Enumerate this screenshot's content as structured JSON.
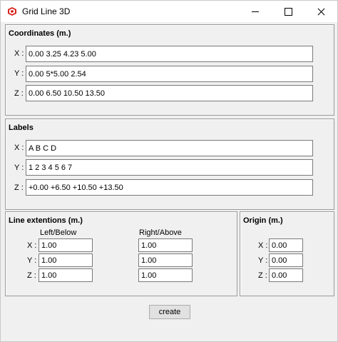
{
  "window": {
    "title": "Grid Line 3D"
  },
  "coordinates": {
    "title": "Coordinates (m.)",
    "rows": [
      {
        "label": "X :",
        "value": "0.00 3.25 4.23 5.00"
      },
      {
        "label": "Y :",
        "value": "0.00 5*5.00 2.54"
      },
      {
        "label": "Z :",
        "value": "0.00 6.50 10.50 13.50"
      }
    ]
  },
  "labels": {
    "title": "Labels",
    "rows": [
      {
        "label": "X :",
        "value": "A B C D"
      },
      {
        "label": "Y :",
        "value": "1 2 3 4 5 6 7"
      },
      {
        "label": "Z :",
        "value": "+0.00 +6.50 +10.50 +13.50"
      }
    ]
  },
  "extensions": {
    "title": "Line extentions (m.)",
    "col_left": "Left/Below",
    "col_right": "Right/Above",
    "rows": [
      {
        "label": "X :",
        "left": "1.00",
        "right": "1.00"
      },
      {
        "label": "Y :",
        "left": "1.00",
        "right": "1.00"
      },
      {
        "label": "Z :",
        "left": "1.00",
        "right": "1.00"
      }
    ]
  },
  "origin": {
    "title": "Origin (m.)",
    "rows": [
      {
        "label": "X :",
        "value": "0.00"
      },
      {
        "label": "Y :",
        "value": "0.00"
      },
      {
        "label": "Z :",
        "value": "0.00"
      }
    ]
  },
  "actions": {
    "create_label": "create"
  },
  "colors": {
    "window_bg": "#f0f0f0",
    "icon_red": "#d9251d"
  }
}
